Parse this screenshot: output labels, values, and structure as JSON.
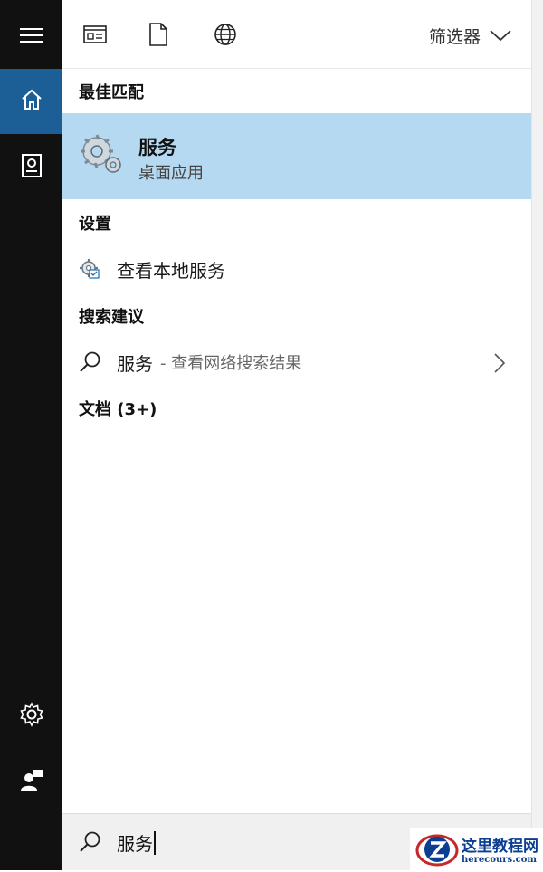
{
  "topbar": {
    "filter_label": "筛选器"
  },
  "sections": {
    "best_match": "最佳匹配",
    "settings": "设置",
    "suggestions": "搜索建议",
    "documents": "文档 (3+)"
  },
  "best_match": {
    "title": "服务",
    "subtitle": "桌面应用"
  },
  "settings_item": {
    "label": "查看本地服务"
  },
  "suggestion_item": {
    "query": "服务",
    "hint": "- 查看网络搜索结果"
  },
  "search": {
    "value": "服务"
  },
  "watermark": {
    "title": "这里教程网",
    "url": "herecours.com"
  },
  "colors": {
    "rail": "#111111",
    "rail_active": "#1b5f96",
    "highlight": "#b6d9f2",
    "search_bg": "#f0f0f0"
  }
}
